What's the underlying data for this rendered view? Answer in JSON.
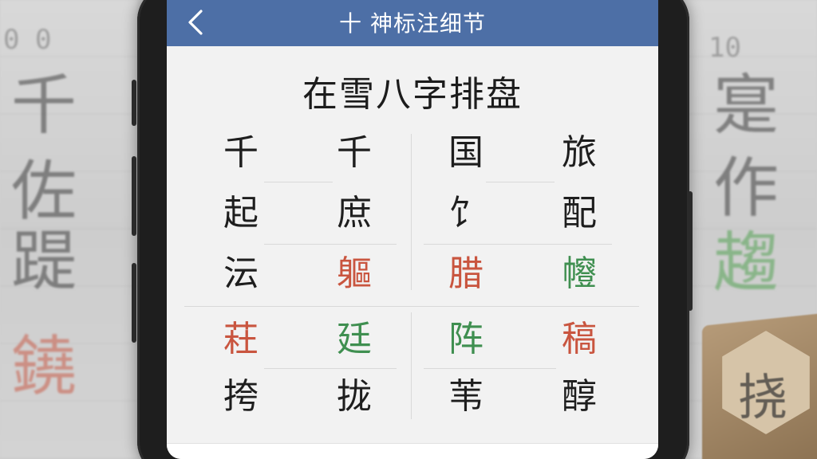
{
  "header": {
    "title": "十 神标注细节",
    "back_icon": "chevron-left-icon"
  },
  "main": {
    "heading": "在雪八字排盘",
    "rows": [
      [
        {
          "char": "千",
          "tone": "black"
        },
        {
          "char": "千",
          "tone": "black"
        },
        {
          "char": "国",
          "tone": "black"
        },
        {
          "char": "旅",
          "tone": "black"
        }
      ],
      [
        {
          "char": "起",
          "tone": "black"
        },
        {
          "char": "庶",
          "tone": "black"
        },
        {
          "char": "饣",
          "tone": "black"
        },
        {
          "char": "配",
          "tone": "black"
        }
      ],
      [
        {
          "char": "沄",
          "tone": "black"
        },
        {
          "char": "軀",
          "tone": "red"
        },
        {
          "char": "腊",
          "tone": "red"
        },
        {
          "char": "㡧",
          "tone": "green"
        }
      ],
      [
        {
          "char": "荰",
          "tone": "red"
        },
        {
          "char": "廷",
          "tone": "green"
        },
        {
          "char": "阵",
          "tone": "green"
        },
        {
          "char": "稿",
          "tone": "red"
        }
      ],
      [
        {
          "char": "挎",
          "tone": "black"
        },
        {
          "char": "拢",
          "tone": "black"
        },
        {
          "char": "苇",
          "tone": "black"
        },
        {
          "char": "醇",
          "tone": "black"
        }
      ]
    ]
  },
  "background": {
    "left_numbers": [
      "0",
      "0"
    ],
    "left_chars": [
      {
        "char": "千",
        "tone": "black"
      },
      {
        "char": "佐",
        "tone": "black"
      },
      {
        "char": "踶",
        "tone": "black"
      },
      {
        "char": "鐃",
        "tone": "red"
      }
    ],
    "right_numbers": [
      "10"
    ],
    "right_chars": [
      {
        "char": "寔",
        "tone": "black"
      },
      {
        "char": "作",
        "tone": "black"
      },
      {
        "char": "趨",
        "tone": "green"
      }
    ],
    "block_char": "挠"
  },
  "colors": {
    "header_bg": "#4d6fa6",
    "red": "#c9553f",
    "green": "#3f8f50",
    "text": "#1e1e1e"
  }
}
